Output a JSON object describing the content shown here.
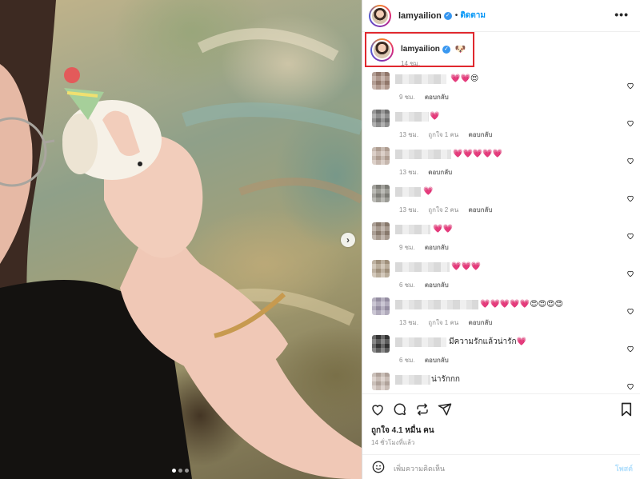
{
  "post": {
    "username": "lamyailion",
    "verified_mark": "✓",
    "separator": "•",
    "follow_label": "ติดตาม",
    "more_label": "•••",
    "caption_emoji": "🐶",
    "caption_time": "14 ชม.",
    "carousel_next": "›",
    "likes_text": "ถูกใจ 4.1 หมื่น คน",
    "time_ago": "14 ชั่วโมงที่แล้ว",
    "add_comment_placeholder": "เพิ่มความคิดเห็น",
    "post_button": "โพสต์"
  },
  "comments": [
    {
      "text": "💗💗😍",
      "time": "9 ชม.",
      "likes": "",
      "reply": "ตอบกลับ",
      "avatar_color": "#a6887a"
    },
    {
      "text": "💗",
      "time": "13 ชม.",
      "likes": "ถูกใจ 1 คน",
      "reply": "ตอบกลับ",
      "avatar_color": "#7d7d7d"
    },
    {
      "text": "💗💗💗💗💗",
      "time": "13 ชม.",
      "likes": "",
      "reply": "ตอบกลับ",
      "avatar_color": "#c6b2a5"
    },
    {
      "text": "💗",
      "time": "13 ชม.",
      "likes": "ถูกใจ 2 คน",
      "reply": "ตอบกลับ",
      "avatar_color": "#8e8d86"
    },
    {
      "text": "💗💗",
      "time": "9 ชม.",
      "likes": "",
      "reply": "ตอบกลับ",
      "avatar_color": "#9b8a7c"
    },
    {
      "text": "💗💗💗",
      "time": "6 ชม.",
      "likes": "",
      "reply": "ตอบกลับ",
      "avatar_color": "#b6a58e"
    },
    {
      "text": "💗💗💗💗💗😍😍😍😍",
      "time": "13 ชม.",
      "likes": "ถูกใจ 1 คน",
      "reply": "ตอบกลับ",
      "avatar_color": "#a9a1b8"
    },
    {
      "text": "มีความรักแล้วน่ารัก💗",
      "time": "6 ชม.",
      "likes": "",
      "reply": "ตอบกลับ",
      "avatar_color": "#3a3a3a"
    },
    {
      "text": "น่ารักกก",
      "time": "",
      "likes": "",
      "reply": "",
      "avatar_color": "#c9b9b0"
    }
  ],
  "icons": {
    "like": "heart-icon",
    "comment": "comment-icon",
    "share": "share-icon",
    "save": "bookmark-icon",
    "emoji": "smiley-icon"
  },
  "colors": {
    "accent": "#0095f6",
    "highlight_border": "#e0282e"
  }
}
